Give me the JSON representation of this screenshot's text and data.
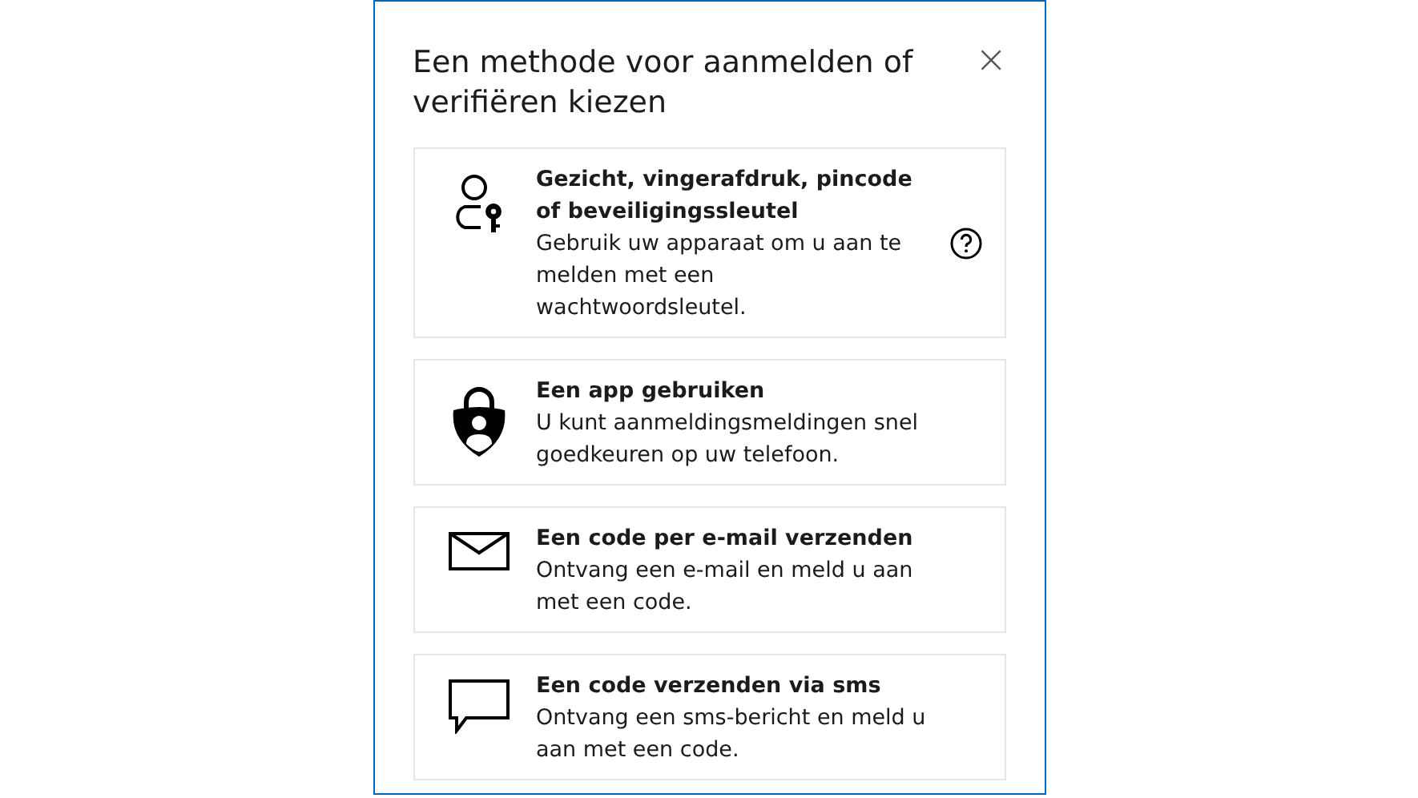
{
  "dialog": {
    "title": "Een methode voor aanmelden of verifiëren kiezen",
    "close_label": "×",
    "options": [
      {
        "kind": "passkey",
        "title": "Gezicht, vingerafdruk, pincode of beveiligingssleutel",
        "description": "Gebruik uw apparaat om u aan te melden met een wachtwoordsleutel.",
        "help": true
      },
      {
        "kind": "authenticator",
        "title": "Een app gebruiken",
        "description": "U kunt aanmeldingsmeldingen snel goedkeuren op uw telefoon.",
        "help": false
      },
      {
        "kind": "email",
        "title": "Een code per e-mail verzenden",
        "description": "Ontvang een e-mail en meld u aan met een code.",
        "help": false
      },
      {
        "kind": "sms",
        "title": "Een code verzenden via sms",
        "description": "Ontvang een sms-bericht en meld u aan met een code.",
        "help": false
      }
    ]
  }
}
